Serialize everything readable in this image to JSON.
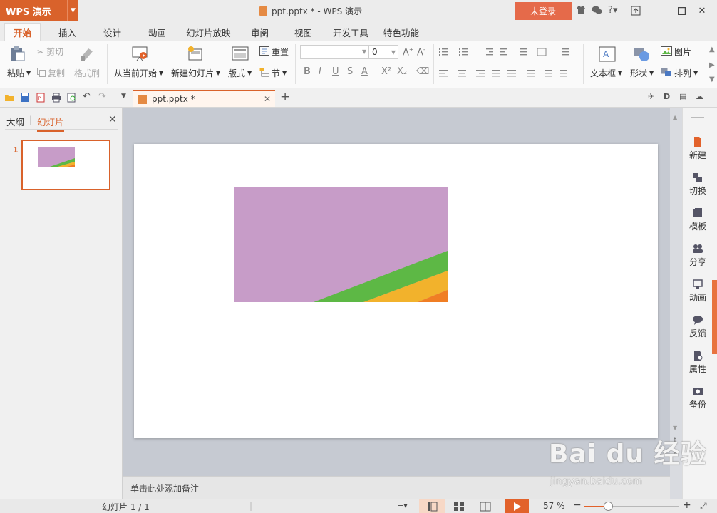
{
  "app": {
    "logo": "WPS 演示",
    "title": "ppt.pptx * - WPS 演示",
    "login_label": "未登录"
  },
  "menu": {
    "tabs": [
      "开始",
      "插入",
      "设计",
      "动画",
      "幻灯片放映",
      "审阅",
      "视图",
      "开发工具",
      "特色功能"
    ],
    "active": "开始"
  },
  "ribbon": {
    "paste": "粘贴",
    "cut": "剪切",
    "copy": "复制",
    "format_painter": "格式刷",
    "from_current": "从当前开始",
    "new_slide": "新建幻灯片",
    "layout": "版式",
    "reset": "重置",
    "section": "节",
    "font_size": "0",
    "textbox": "文本框",
    "shape": "形状",
    "picture": "图片",
    "arrange": "排列"
  },
  "doc_tab": {
    "name": "ppt.pptx *"
  },
  "left_panel": {
    "tab_outline": "大纲",
    "tab_slides": "幻灯片",
    "slide_number": "1"
  },
  "notes_placeholder": "单击此处添加备注",
  "right_panel": {
    "items": [
      "新建",
      "切换",
      "模板",
      "分享",
      "动画",
      "反馈",
      "属性",
      "备份"
    ]
  },
  "status": {
    "slide_info": "幻灯片 1 / 1",
    "zoom": "57 %"
  },
  "colors": {
    "accent": "#d9622b",
    "shape_purple": "#c79cc8",
    "shape_green": "#5db845",
    "shape_yellow": "#f2b22c",
    "shape_orange": "#f07e24"
  },
  "watermark": {
    "brand": "Bai du 经验",
    "url": "jingyan.baidu.com"
  }
}
